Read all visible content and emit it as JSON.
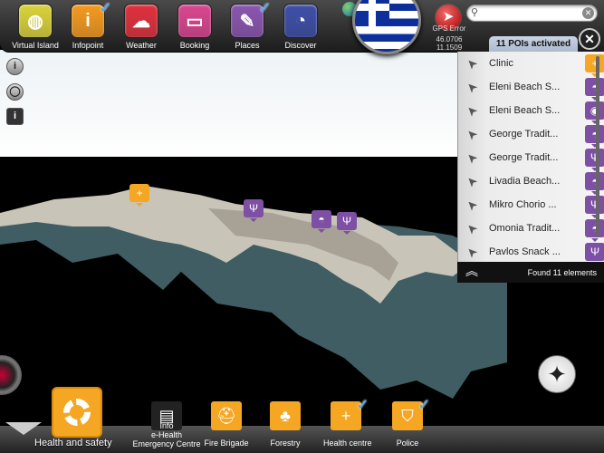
{
  "top_apps": [
    {
      "label": "Virtual Island",
      "color": "#d9d23a",
      "glyph": "◍",
      "checked": false
    },
    {
      "label": "Infopoint",
      "color": "#f39a1e",
      "glyph": "i",
      "checked": true
    },
    {
      "label": "Weather",
      "color": "#e0303c",
      "glyph": "☁",
      "checked": false
    },
    {
      "label": "Booking",
      "color": "#d9458f",
      "glyph": "▭",
      "checked": false
    },
    {
      "label": "Places",
      "color": "#8a55b0",
      "glyph": "✎",
      "checked": true
    },
    {
      "label": "Discover",
      "color": "#3d4ea8",
      "glyph": "◔",
      "checked": false
    }
  ],
  "gps": {
    "label": "GPS Error",
    "lat": "46.0706",
    "lon": "11.1509"
  },
  "search": {
    "placeholder": "",
    "value": ""
  },
  "poi_tab": "11 POIs activated",
  "poi_list": [
    {
      "name": "Clinic",
      "type": "orange",
      "glyph": "+"
    },
    {
      "name": "Eleni Beach S...",
      "type": "purple",
      "glyph": "◓"
    },
    {
      "name": "Eleni Beach S...",
      "type": "purple",
      "glyph": "◉"
    },
    {
      "name": "George Tradit...",
      "type": "purple",
      "glyph": "◓"
    },
    {
      "name": "George Tradit...",
      "type": "purple",
      "glyph": "Ψ"
    },
    {
      "name": "Livadia Beach...",
      "type": "purple",
      "glyph": "◓"
    },
    {
      "name": "Mikro Chorio ...",
      "type": "purple",
      "glyph": "Ψ"
    },
    {
      "name": "Omonia Tradit...",
      "type": "purple",
      "glyph": "◓"
    },
    {
      "name": "Pavlos Snack ...",
      "type": "purple",
      "glyph": "Ψ"
    }
  ],
  "list_footer": "Found 11 elements",
  "categories": {
    "main": "Health and safety",
    "items": [
      {
        "label": "e-Health Emergency Centre",
        "overlay": "Info",
        "checked": false
      },
      {
        "label": "Fire Brigade",
        "checked": false
      },
      {
        "label": "Forestry",
        "checked": false
      },
      {
        "label": "Health centre",
        "checked": true
      },
      {
        "label": "Police",
        "checked": true
      }
    ]
  }
}
